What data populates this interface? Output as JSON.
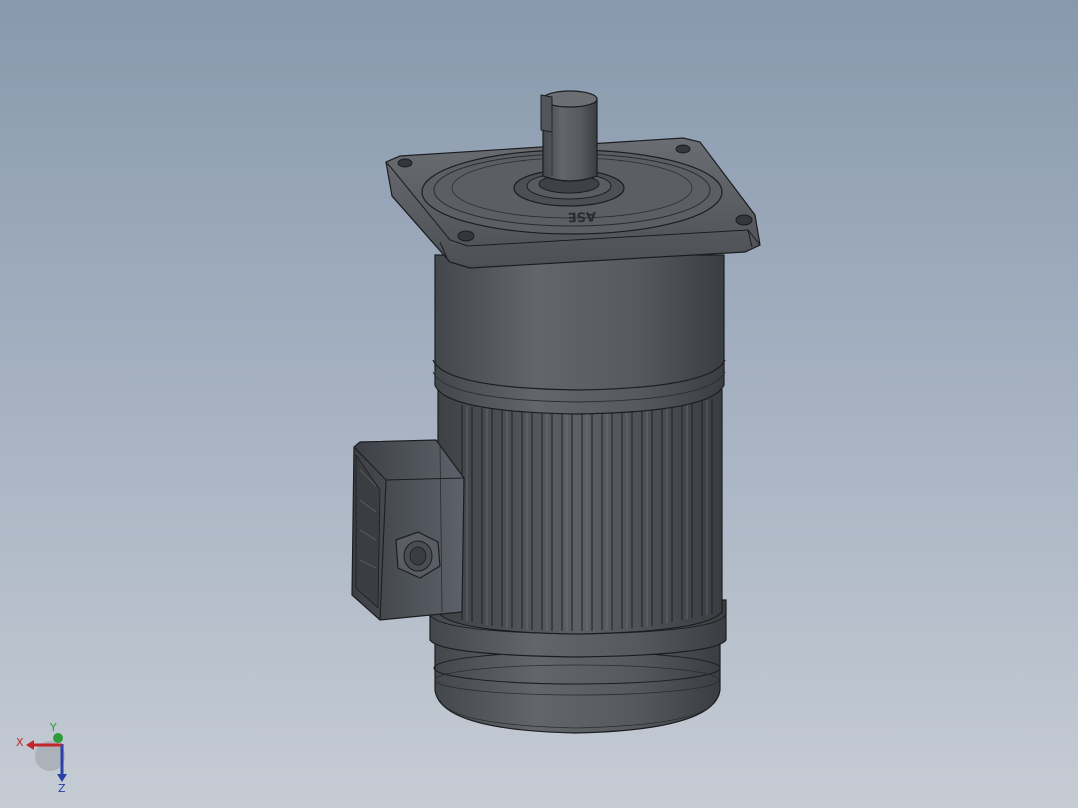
{
  "viewport": {
    "background_top": "#8899ad",
    "background_bottom": "#c6ccd4"
  },
  "model": {
    "flange_marking": "ASE",
    "body_color": "#55595e",
    "body_dark": "#3b3e42",
    "edge_color": "#1c1d1f",
    "terminal_box_color": "#4a4e55"
  },
  "triad": {
    "x_label": "X",
    "y_label": "Y",
    "z_label": "Z",
    "x_color": "#c0262a",
    "y_color": "#2e9a3a",
    "z_color": "#2840a8"
  }
}
